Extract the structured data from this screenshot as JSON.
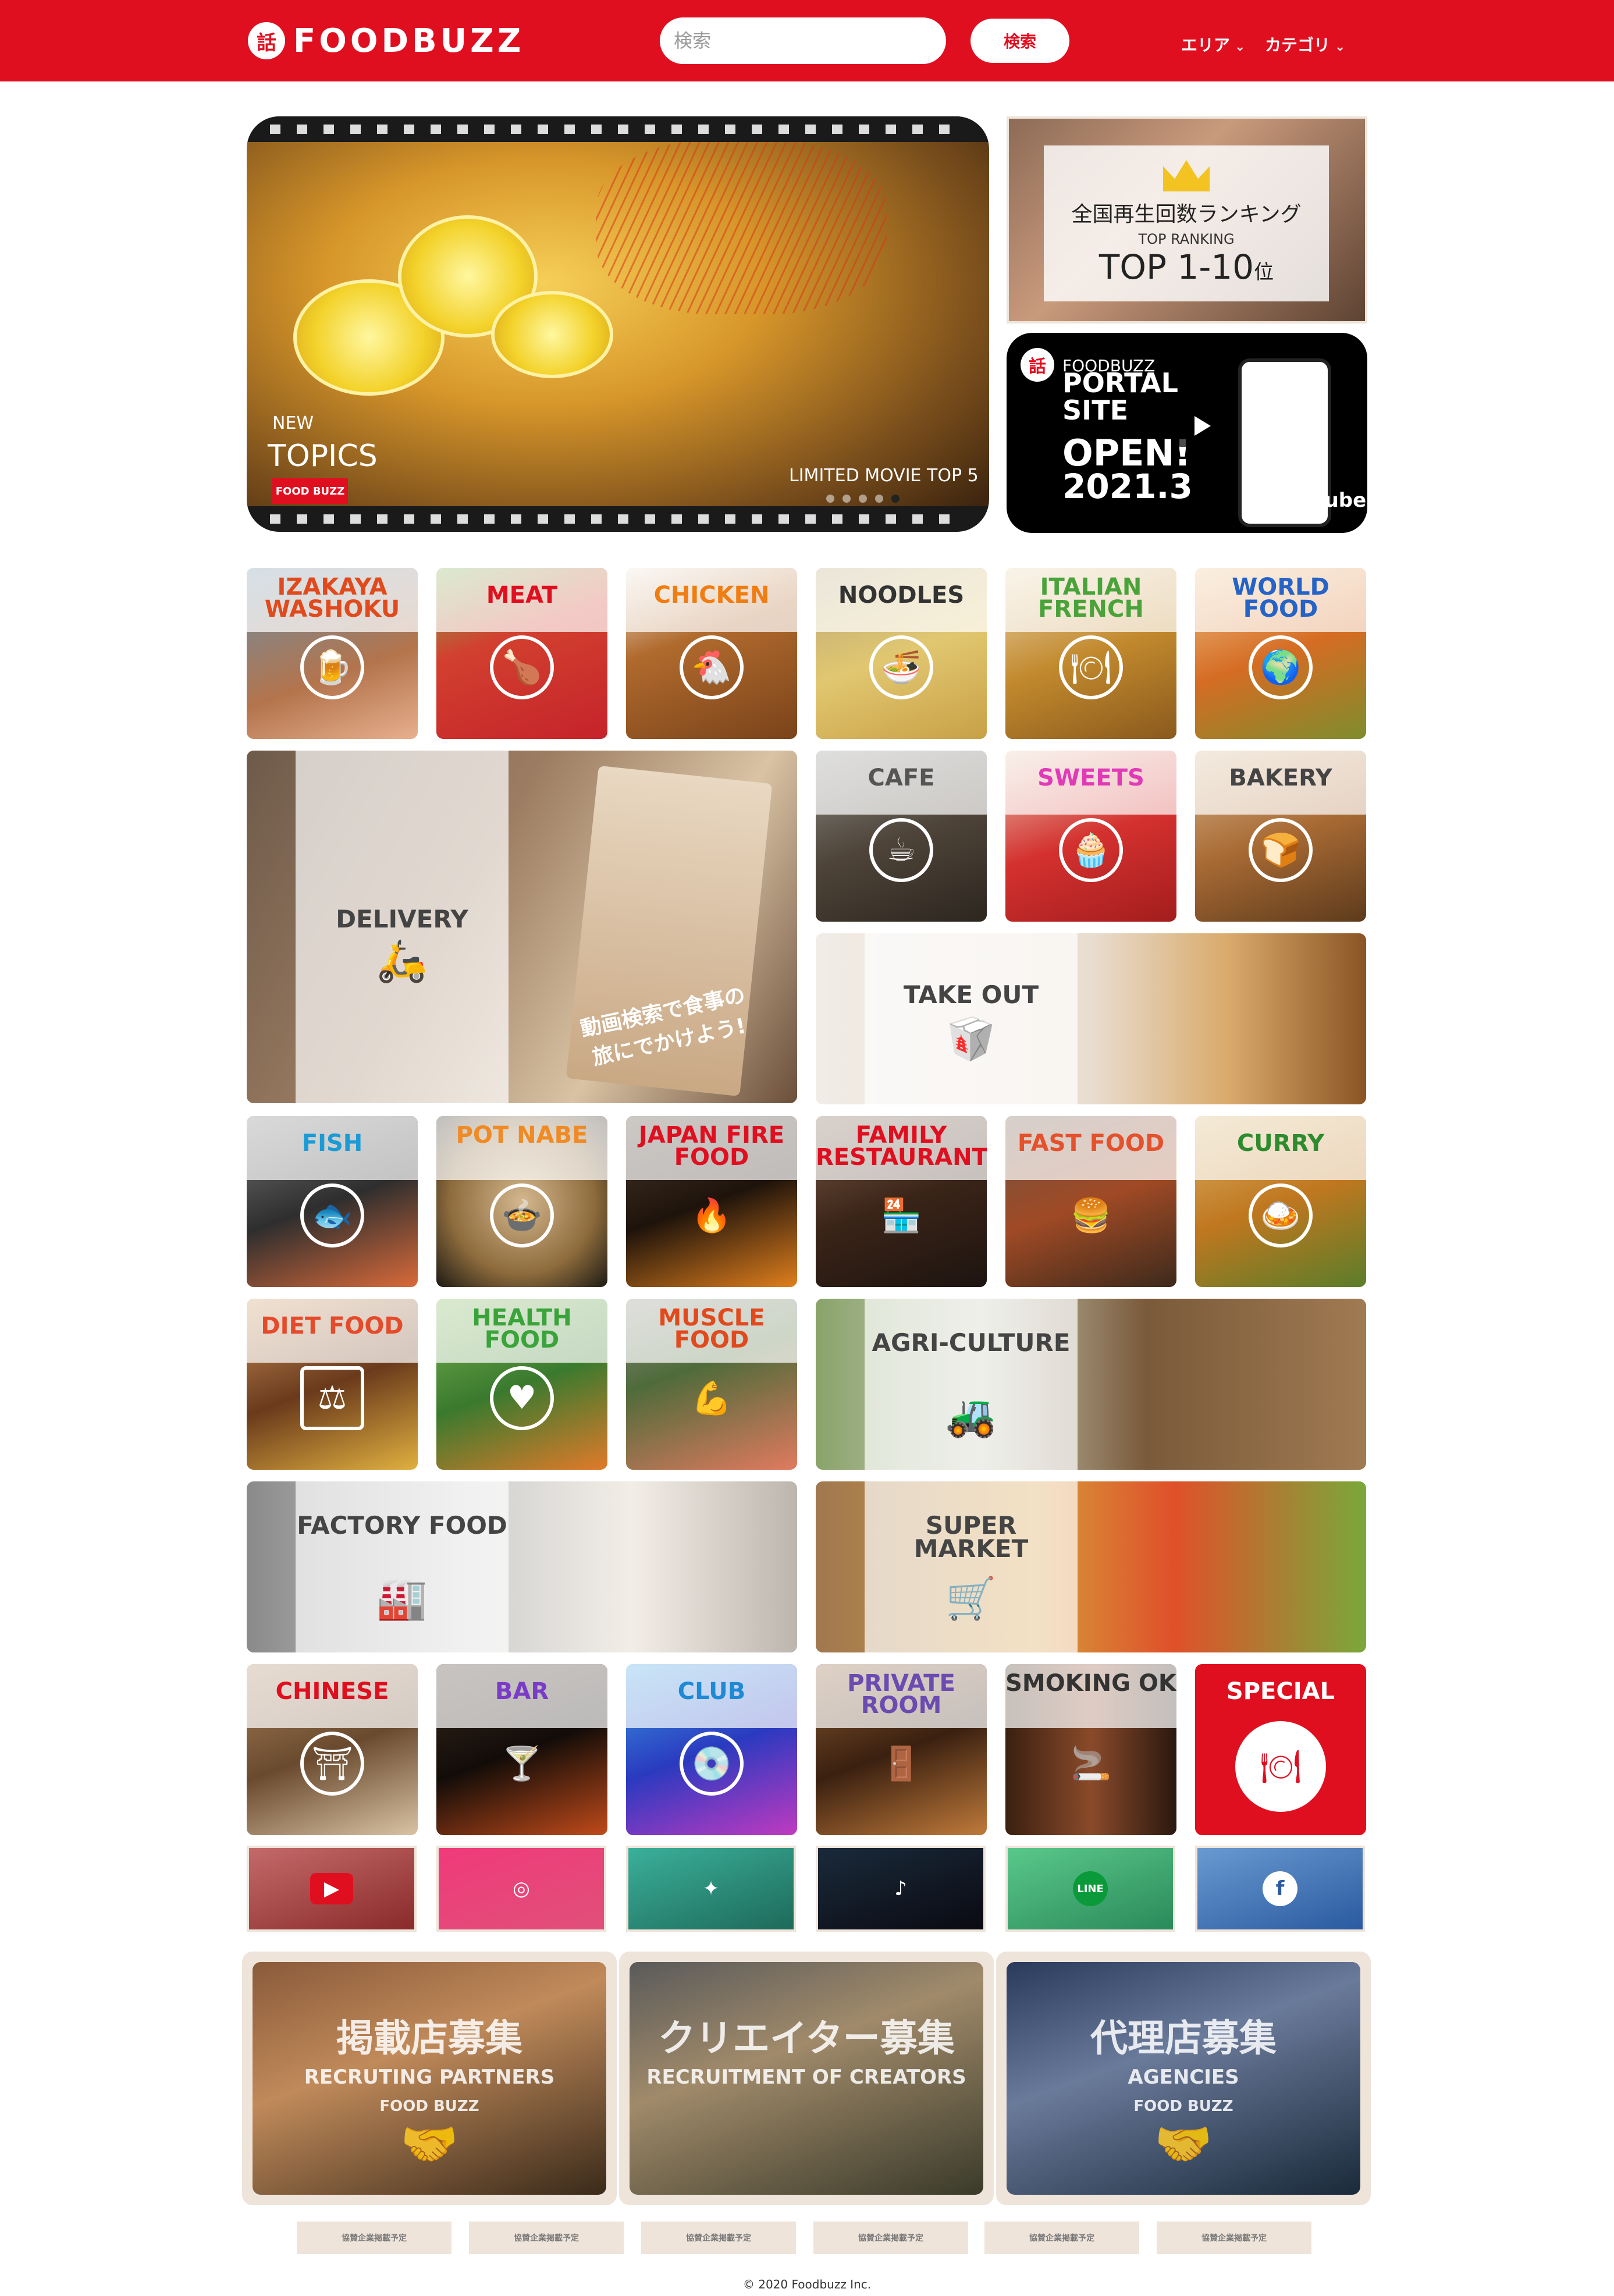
{
  "header": {
    "logo_mark": "話",
    "logo_text": "FOODBUZZ",
    "search_placeholder": "検索",
    "search_button": "検索",
    "nav": [
      {
        "label": "エリア"
      },
      {
        "label": "カテゴリ"
      }
    ],
    "bg_color": "#e00f20"
  },
  "hero": {
    "new_label": "NEW",
    "topics_label": "TOPICS",
    "badge": "FOOD BUZZ",
    "limited": "LIMITED MOVIE TOP 5",
    "slides": 5,
    "active_slide": 5
  },
  "ranking": {
    "title_jp": "全国再生回数ランキング",
    "subtitle": "TOP RANKING",
    "range": "TOP 1-10",
    "unit": "位"
  },
  "portal": {
    "logo_mark": "話",
    "brand": "FOODBUZZ",
    "line1": "PORTAL",
    "line2": "SITE",
    "line3": "OPEN!",
    "date": "2021.3",
    "yt": "YouTube"
  },
  "categories": {
    "izakaya": "IZAKAYA WASHOKU",
    "meat": "MEAT",
    "chicken": "CHICKEN",
    "noodles": "NOODLES",
    "italian": "ITALIAN FRENCH",
    "world": "WORLD FOOD",
    "delivery": "DELIVERY",
    "delivery_promo": "動画検索で食事の旅にでかけよう!",
    "cafe": "CAFE",
    "sweets": "SWEETS",
    "bakery": "BAKERY",
    "takeout": "TAKE OUT",
    "fish": "FISH",
    "potnabe": "POT NABE",
    "japanfire": "JAPAN FIRE FOOD",
    "family": "FAMILY RESTAURANT",
    "fastfood": "FAST FOOD",
    "curry": "CURRY",
    "diet": "DIET FOOD",
    "health": "HEALTH FOOD",
    "muscle": "MUSCLE FOOD",
    "agri": "AGRI-CULTURE",
    "factory": "FACTORY FOOD",
    "super": "SUPER MARKET",
    "chinese": "CHINESE",
    "bar": "BAR",
    "club": "CLUB",
    "private": "PRIVATE ROOM",
    "smoking": "SMOKING OK",
    "special": "SPECIAL"
  },
  "colors": {
    "izakaya": "#e04a1d",
    "meat": "#e00f20",
    "chicken": "#ef7d12",
    "noodles": "#333333",
    "italian": "#4aa33a",
    "world": "#2563c7",
    "cafe": "#555555",
    "sweets": "#e03ab7",
    "bakery": "#444444",
    "fish": "#1a9bd6",
    "potnabe": "#f08a24",
    "japanfire": "#e00f20",
    "family": "#e00f20",
    "fastfood": "#e4512c",
    "curry": "#2e8b2e",
    "diet": "#e44b2b",
    "health": "#3aa33a",
    "muscle": "#e04a1d",
    "chinese": "#e00f20",
    "bar": "#7a3cc7",
    "club": "#1e8ad6",
    "private": "#6b4bb0",
    "smoking": "#333333",
    "special_bg": "#e00f20"
  },
  "social": [
    {
      "name": "youtube-icon",
      "glyph": "▶"
    },
    {
      "name": "instagram-icon",
      "glyph": "◎"
    },
    {
      "name": "twitter-icon",
      "glyph": "✦"
    },
    {
      "name": "tiktok-icon",
      "glyph": "♪"
    },
    {
      "name": "line-icon",
      "glyph": "LINE"
    },
    {
      "name": "facebook-icon",
      "glyph": "f"
    }
  ],
  "recruit": [
    {
      "jp": "掲載店募集",
      "en": "RECRUTING PARTNERS",
      "sub": "FOOD BUZZ"
    },
    {
      "jp": "クリエイター募集",
      "en": "RECRUITMENT OF CREATORS",
      "sub": ""
    },
    {
      "jp": "代理店募集",
      "en": "AGENCIES",
      "sub": "FOOD BUZZ"
    }
  ],
  "sponsors": [
    "協賛企業掲載予定",
    "協賛企業掲載予定",
    "協賛企業掲載予定",
    "協賛企業掲載予定",
    "協賛企業掲載予定",
    "協賛企業掲載予定"
  ],
  "footer": "© 2020 Foodbuzz Inc."
}
